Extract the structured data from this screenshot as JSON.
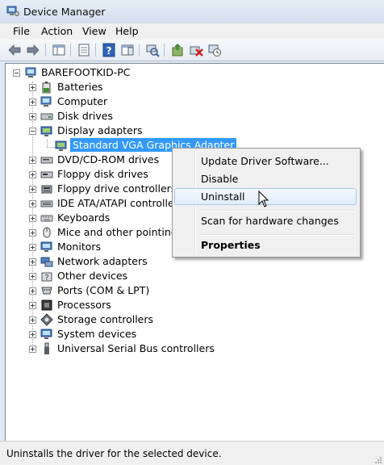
{
  "window": {
    "title": "Device Manager"
  },
  "menu": [
    "File",
    "Action",
    "View",
    "Help"
  ],
  "toolbar": [
    {
      "icon": "back-arrow-icon",
      "enabled": true
    },
    {
      "icon": "forward-arrow-icon",
      "enabled": true
    },
    {
      "icon": "show-hide-tree-icon",
      "enabled": true
    },
    {
      "icon": "properties-icon",
      "enabled": true
    },
    {
      "icon": "help-icon",
      "enabled": true
    },
    {
      "icon": "action-pane-icon",
      "enabled": true
    },
    {
      "icon": "scan-hardware-icon",
      "enabled": true
    },
    {
      "icon": "update-driver-icon",
      "enabled": true
    },
    {
      "icon": "uninstall-device-icon",
      "enabled": true
    },
    {
      "icon": "disable-device-icon",
      "enabled": true
    }
  ],
  "tree": {
    "root": "BAREFOOTKID-PC",
    "categories": [
      {
        "label": "Batteries",
        "icon": "battery-icon",
        "expanded": false
      },
      {
        "label": "Computer",
        "icon": "computer-icon",
        "expanded": false
      },
      {
        "label": "Disk drives",
        "icon": "disk-drive-icon",
        "expanded": false
      },
      {
        "label": "Display adapters",
        "icon": "display-adapter-icon",
        "expanded": true,
        "children": [
          "Standard VGA Graphics Adapter"
        ]
      },
      {
        "label": "DVD/CD-ROM drives",
        "icon": "dvd-drive-icon",
        "expanded": false
      },
      {
        "label": "Floppy disk drives",
        "icon": "floppy-disk-icon",
        "expanded": false
      },
      {
        "label": "Floppy drive controllers",
        "icon": "floppy-controller-icon",
        "expanded": false
      },
      {
        "label": "IDE ATA/ATAPI controllers",
        "icon": "ide-controller-icon",
        "expanded": false
      },
      {
        "label": "Keyboards",
        "icon": "keyboard-icon",
        "expanded": false
      },
      {
        "label": "Mice and other pointing de",
        "icon": "mouse-icon",
        "expanded": false
      },
      {
        "label": "Monitors",
        "icon": "monitor-icon",
        "expanded": false
      },
      {
        "label": "Network adapters",
        "icon": "network-adapter-icon",
        "expanded": false
      },
      {
        "label": "Other devices",
        "icon": "other-device-icon",
        "expanded": false
      },
      {
        "label": "Ports (COM & LPT)",
        "icon": "port-icon",
        "expanded": false
      },
      {
        "label": "Processors",
        "icon": "processor-icon",
        "expanded": false
      },
      {
        "label": "Storage controllers",
        "icon": "storage-controller-icon",
        "expanded": false
      },
      {
        "label": "System devices",
        "icon": "system-device-icon",
        "expanded": false
      },
      {
        "label": "Universal Serial Bus controllers",
        "icon": "usb-icon",
        "expanded": false
      }
    ]
  },
  "context_menu": {
    "items": [
      {
        "label": "Update Driver Software...",
        "bold": false,
        "hover": false
      },
      {
        "label": "Disable",
        "bold": false,
        "hover": false
      },
      {
        "label": "Uninstall",
        "bold": false,
        "hover": true
      },
      {
        "separator": true
      },
      {
        "label": "Scan for hardware changes",
        "bold": false,
        "hover": false
      },
      {
        "separator": true
      },
      {
        "label": "Properties",
        "bold": true,
        "hover": false
      }
    ]
  },
  "status": {
    "text": "Uninstalls the driver for the selected device."
  },
  "colors": {
    "selection": "#3399ff",
    "menu_hover_border": "#a8c8ed"
  }
}
